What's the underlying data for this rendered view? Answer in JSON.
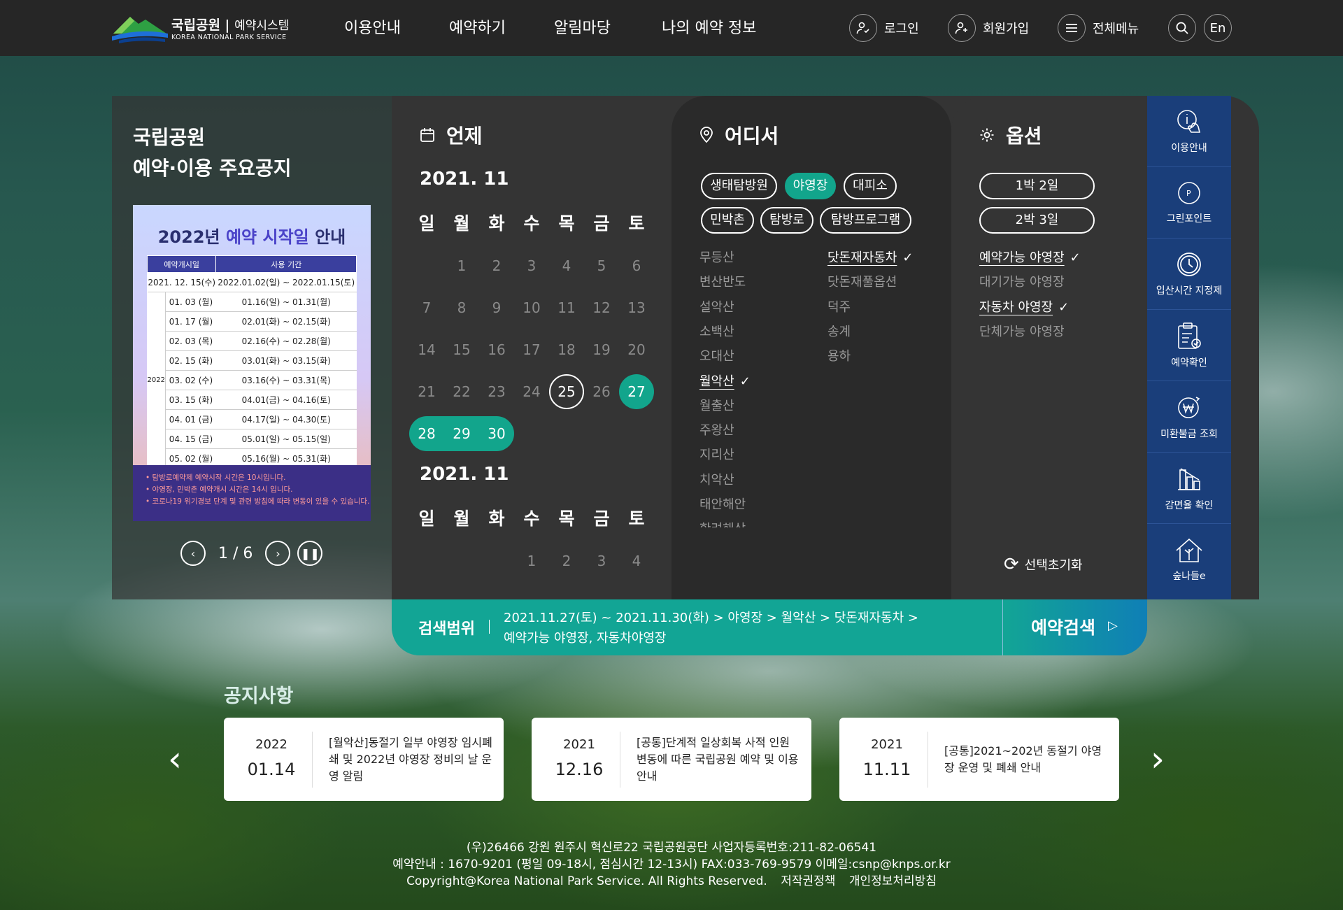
{
  "colors": {
    "accent": "#12a58c",
    "header_bg": "#262626",
    "quick_bg": "#1a3e7a",
    "panel_bg": "#343434"
  },
  "header": {
    "logo_ko": "국립공원",
    "logo_sub": "예약시스템",
    "logo_en": "KOREA NATIONAL PARK SERVICE",
    "nav": [
      "이용안내",
      "예약하기",
      "알림마당",
      "나의 예약 정보"
    ],
    "login": "로그인",
    "signup": "회원가입",
    "all_menu": "전체메뉴",
    "lang": "En",
    "icons": {
      "login": "user-check-icon",
      "signup": "user-plus-icon",
      "menu": "hamburger-icon",
      "search": "search-icon"
    }
  },
  "notice_panel": {
    "title_line1": "국립공원",
    "title_line2": "예약·이용 주요공지",
    "poster": {
      "title_a": "2022년 ",
      "title_b": "예약 시작일",
      "title_c": " 안내",
      "col1": "예약개시일",
      "col2": "사용 기간",
      "first_row": [
        "2021. 12. 15(수)",
        "2022.01.02(일) ~ 2022.01.15(토)"
      ],
      "year": "2022",
      "rows": [
        [
          "01. 03 (월)",
          "01.16(일) ~ 01.31(월)"
        ],
        [
          "01. 17 (월)",
          "02.01(화) ~ 02.15(화)"
        ],
        [
          "02. 03 (목)",
          "02.16(수) ~ 02.28(월)"
        ],
        [
          "02. 15 (화)",
          "03.01(화) ~ 03.15(화)"
        ],
        [
          "03. 02 (수)",
          "03.16(수) ~ 03.31(목)"
        ],
        [
          "03. 15 (화)",
          "04.01(금) ~ 04.16(토)"
        ],
        [
          "04. 01 (금)",
          "04.17(일) ~ 04.30(토)"
        ],
        [
          "04. 15 (금)",
          "05.01(일) ~ 05.15(일)"
        ],
        [
          "05. 02 (월)",
          "05.16(월) ~ 05.31(화)"
        ]
      ],
      "notes": [
        "탐방로예약제 예약시작 시간은 10시입니다.",
        "야영장, 민박촌 예약개시 시간은 14시 입니다.",
        "코로나19 위기경보 단계 및 관련 방침에 따라 변동이 있을 수 있습니다."
      ]
    },
    "pager": {
      "current": "1",
      "total": "6",
      "text": "1 / 6"
    }
  },
  "when": {
    "heading": "언제",
    "weekdays": [
      "일",
      "월",
      "화",
      "수",
      "목",
      "금",
      "토"
    ],
    "month1": {
      "label": "2021. 11",
      "weeks": [
        [
          "",
          "1",
          "2",
          "3",
          "4",
          "5",
          "6"
        ],
        [
          "7",
          "8",
          "9",
          "10",
          "11",
          "12",
          "13"
        ],
        [
          "14",
          "15",
          "16",
          "17",
          "18",
          "19",
          "20"
        ],
        [
          "21",
          "22",
          "23",
          "24",
          "25",
          "26",
          "27"
        ],
        [
          "28",
          "29",
          "30",
          "",
          "",
          "",
          ""
        ]
      ],
      "today": "25",
      "selected": [
        "27",
        "28",
        "29",
        "30"
      ]
    },
    "month2": {
      "label": "2021. 11",
      "weeks": [
        [
          "",
          "",
          "",
          "1",
          "2",
          "3",
          "4"
        ]
      ]
    }
  },
  "where": {
    "heading": "어디서",
    "types": [
      {
        "label": "생태탐방원",
        "on": false
      },
      {
        "label": "야영장",
        "on": true
      },
      {
        "label": "대피소",
        "on": false
      },
      {
        "label": "민박촌",
        "on": false
      },
      {
        "label": "탐방로",
        "on": false
      },
      {
        "label": "탐방프로그램",
        "on": false
      }
    ],
    "parks": [
      "무등산",
      "변산반도",
      "설악산",
      "소백산",
      "오대산",
      "월악산",
      "월출산",
      "주왕산",
      "지리산",
      "치악산",
      "태안해안",
      "한려해상"
    ],
    "selected_park": "월악산",
    "sites": [
      "닷돈재자동차",
      "닷돈재풀옵션",
      "덕주",
      "송계",
      "용하"
    ],
    "selected_site": "닷돈재자동차"
  },
  "options": {
    "heading": "옵션",
    "stays": [
      "1박 2일",
      "2박 3일"
    ],
    "filters": [
      {
        "label": "예약가능 야영장",
        "on": true
      },
      {
        "label": "대기가능 야영장",
        "on": false
      },
      {
        "label": "자동차 야영장",
        "on": true
      },
      {
        "label": "단체가능 야영장",
        "on": false
      }
    ],
    "reset": "선택초기화"
  },
  "quick_menu": [
    {
      "label": "이용안내",
      "icon": "info-hand-icon"
    },
    {
      "label": "그린포인트",
      "icon": "green-point-icon"
    },
    {
      "label": "입산시간 지정제",
      "icon": "clock-icon"
    },
    {
      "label": "예약확인",
      "icon": "clipboard-check-icon"
    },
    {
      "label": "미환불금 조회",
      "icon": "won-refund-icon"
    },
    {
      "label": "감면율 확인",
      "icon": "chart-bars-icon"
    },
    {
      "label": "숲나들e",
      "icon": "tree-house-icon"
    }
  ],
  "search_bar": {
    "label": "검색범위",
    "line1": "2021.11.27(토) ~ 2021.11.30(화)  >  야영장  >  월악산  >  닷돈재자동차  >",
    "line2": "예약가능 야영장, 자동차야영장",
    "button": "예약검색"
  },
  "notices": {
    "title": "공지사항",
    "items": [
      {
        "year": "2022",
        "date": "01.14",
        "text": "[월악산]동절기 일부 야영장 임시폐쇄 및 2022년 야영장 정비의 날 운영 알림"
      },
      {
        "year": "2021",
        "date": "12.16",
        "text": "[공통]단계적 일상회복 사적 인원 변동에 따른 국립공원 예약 및 이용안내"
      },
      {
        "year": "2021",
        "date": "11.11",
        "text": "[공통]2021~202년 동절기 야영장 운영 및 폐쇄 안내"
      }
    ]
  },
  "footer": {
    "line1": "(우)26466 강원 원주시 혁신로22 국립공원공단    사업자등록번호:211-82-06541",
    "line2": "예약안내 : 1670-9201 (평일 09-18시, 점심시간 12-13시)    FAX:033-769-9579    이메일:csnp@knps.or.kr",
    "copyright": "Copyright@Korea National Park Service. All Rights Reserved.",
    "link1": "저작권정책",
    "link2": "개인정보처리방침"
  }
}
